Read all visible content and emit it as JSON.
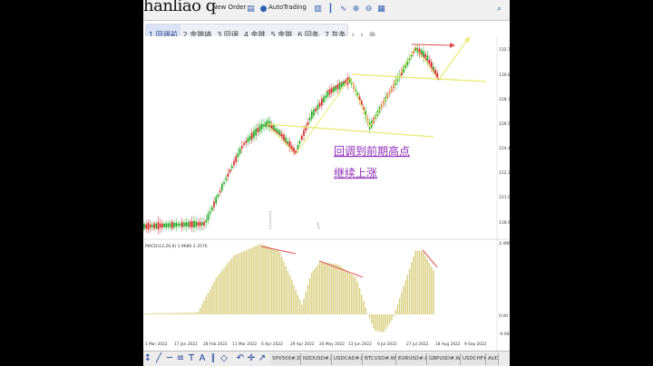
{
  "watermark": "hanliao q",
  "toolbar": {
    "new_order": "New Order",
    "auto_trading": "AutoTrading"
  },
  "tabs": [
    {
      "label": "1 回调前",
      "active": true
    },
    {
      "label": "2 金跳墙",
      "active": false
    },
    {
      "label": "3 回调",
      "active": false
    },
    {
      "label": "4 金跳",
      "active": false
    },
    {
      "label": "5 金跳",
      "active": false
    },
    {
      "label": "6 回条",
      "active": false
    },
    {
      "label": "7 灰条",
      "active": false
    }
  ],
  "tab_nav": {
    "prev": "‹",
    "next": "›",
    "close": "⊗"
  },
  "annotation": {
    "line1": "回调到前期高点",
    "line2": "继续上涨"
  },
  "indicator_label": "MACD(12,26,9) 1.9680 2.3576",
  "price_axis": [
    "132.75",
    "130.850",
    "128.710",
    "126.571",
    "124.400",
    "122.210",
    "121.064",
    "118.900"
  ],
  "indicator_axis": [
    "2.4860",
    "0.00",
    "-0.9412"
  ],
  "time_axis": [
    "1 Mar 2022",
    "17 Jan 2022",
    "28 Feb 2022",
    "11 Mar 2022",
    "6 Apr 2022",
    "29 Apr 2022",
    "20 May 2022",
    "13 Jun 2022",
    "6 Jul 2022",
    "27 Jul 2022",
    "18 Aug 2022",
    "9 Sep 2022"
  ],
  "symbol_tabs": [
    "SPX500#,Daily",
    "NZDUSD#,H4",
    "USDCAD#,Daily",
    "BTCUSD#,Weekly",
    "EURUSD#,Daily",
    "GBPUSD#,Weekly",
    "USDCHF#,H4",
    "AUD"
  ],
  "colors": {
    "bull_candle": "#18a818",
    "bear_candle": "#d32020",
    "trend_line": "#eaea70",
    "arrow": "#e05050",
    "macd_hist": "#d8cc7a",
    "annotation": "#8f2fb8"
  }
}
